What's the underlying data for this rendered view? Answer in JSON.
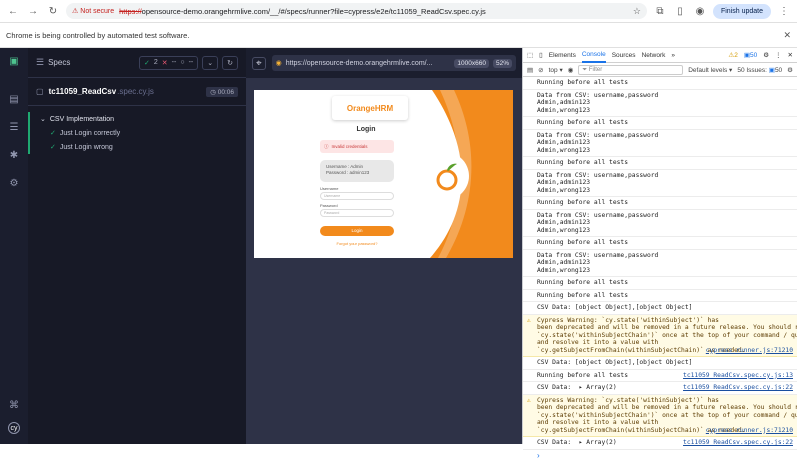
{
  "browser": {
    "not_secure": "Not secure",
    "url_prefix": "https://",
    "url_rest": "opensource-demo.orangehrmlive.com/__/#/specs/runner?file=cypress/e2e/tc11059_ReadCsv.spec.cy.js",
    "finish_update": "Finish update"
  },
  "infobar": {
    "message": "Chrome is being controlled by automated test software."
  },
  "reporter": {
    "specs_label": "Specs",
    "passed": "2",
    "failed": "--",
    "pending": "--",
    "spec_name": "tc11059_ReadCsv",
    "spec_ext": ".spec.cy.js",
    "duration": "00:06",
    "suite": "CSV Implementation",
    "tests": [
      "Just Login correctly",
      "Just Login wrong"
    ]
  },
  "aut": {
    "url": "https://opensource-demo.orangehrmlive.com/...",
    "viewport": "1000x660",
    "zoom": "52%",
    "login_title": "Login",
    "invalid": "Invalid credentials",
    "cred_user": "Username : Admin",
    "cred_pass": "Password : admin123",
    "username_label": "Username",
    "username_ph": "Username",
    "password_label": "Password",
    "password_ph": "Password",
    "login_btn": "Login",
    "forgot": "Forgot your password?",
    "brand": "OrangeHRM"
  },
  "devtools": {
    "tabs": [
      "Elements",
      "Console",
      "Sources",
      "Network"
    ],
    "warn_count": "2",
    "issue_count": "50",
    "context": "top",
    "filter_ph": "Filter",
    "levels": "Default levels",
    "issues": "50 Issues:",
    "issues_count": "50",
    "lines": [
      {
        "type": "log",
        "text": "Running before all tests"
      },
      {
        "type": "log",
        "text": "Data from CSV: username,password\nAdmin,admin123\nAdmin,wrong123"
      },
      {
        "type": "log",
        "text": "Running before all tests"
      },
      {
        "type": "log",
        "text": "Data from CSV: username,password\nAdmin,admin123\nAdmin,wrong123"
      },
      {
        "type": "log",
        "text": "Running before all tests"
      },
      {
        "type": "log",
        "text": "Data from CSV: username,password\nAdmin,admin123\nAdmin,wrong123"
      },
      {
        "type": "log",
        "text": "Running before all tests"
      },
      {
        "type": "log",
        "text": "Data from CSV: username,password\nAdmin,admin123\nAdmin,wrong123"
      },
      {
        "type": "log",
        "text": "Running before all tests"
      },
      {
        "type": "log",
        "text": "Data from CSV: username,password\nAdmin,admin123\nAdmin,wrong123"
      },
      {
        "type": "log",
        "text": "Running before all tests"
      },
      {
        "type": "log",
        "text": "Running before all tests"
      },
      {
        "type": "log",
        "text": "CSV Data: [object Object],[object Object]"
      },
      {
        "type": "warn",
        "text": "Cypress Warning: `cy.state('withinSubject')` has\nbeen deprecated and will be removed in a future release. You should read\n`cy.state('withinSubjectChain')` once at the top of your command / query,\nand resolve it into a value with\n`cy.getSubjectFromChain(withinSubjectChain)` as needed.",
        "src": "cypress_runner.js:71210"
      },
      {
        "type": "log",
        "text": "CSV Data: [object Object],[object Object]"
      },
      {
        "type": "log",
        "text": "Running before all tests",
        "src": "tc11059_ReadCsv.spec.cy.js:13"
      },
      {
        "type": "log",
        "text": "CSV Data:  ▸ Array(2)",
        "src": "tc11059_ReadCsv.spec.cy.js:22"
      },
      {
        "type": "warn",
        "text": "Cypress Warning: `cy.state('withinSubject')` has\nbeen deprecated and will be removed in a future release. You should read\n`cy.state('withinSubjectChain')` once at the top of your command / query,\nand resolve it into a value with\n`cy.getSubjectFromChain(withinSubjectChain)` as needed.",
        "src": "cypress_runner.js:71210"
      },
      {
        "type": "log",
        "text": "CSV Data:  ▸ Array(2)",
        "src": "tc11059_ReadCsv.spec.cy.js:22"
      }
    ]
  }
}
